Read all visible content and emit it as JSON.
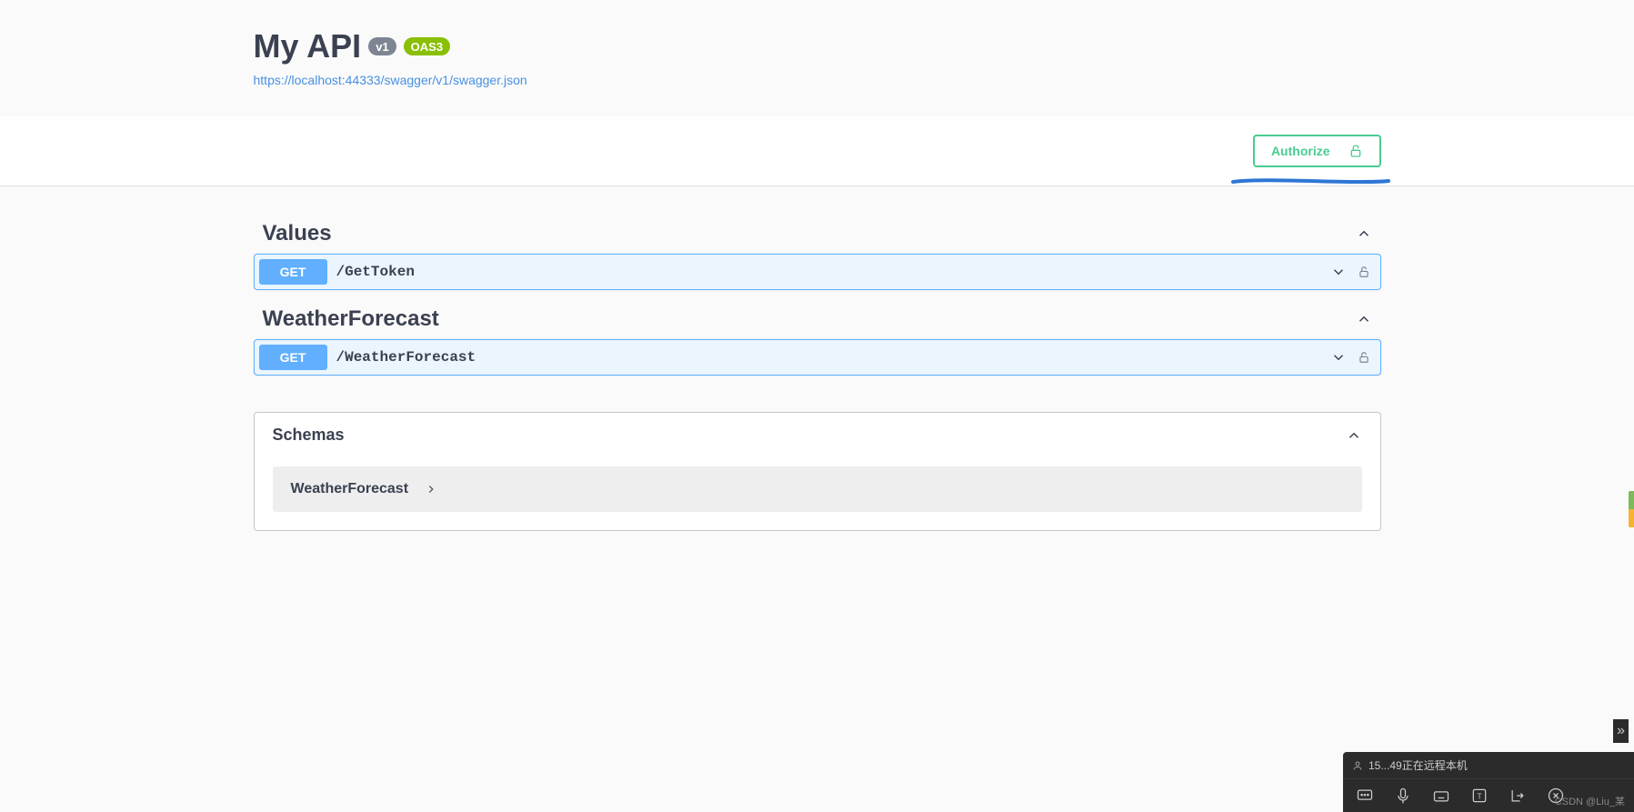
{
  "header": {
    "title": "My API",
    "version_badge": "v1",
    "oas_badge": "OAS3",
    "swagger_url": "https://localhost:44333/swagger/v1/swagger.json"
  },
  "authorize": {
    "label": "Authorize"
  },
  "tags": [
    {
      "name": "Values",
      "operations": [
        {
          "method": "GET",
          "path": "/GetToken"
        }
      ]
    },
    {
      "name": "WeatherForecast",
      "operations": [
        {
          "method": "GET",
          "path": "/WeatherForecast"
        }
      ]
    }
  ],
  "schemas": {
    "title": "Schemas",
    "items": [
      {
        "name": "WeatherForecast"
      }
    ]
  },
  "ime": {
    "status_text": "15...49正在远程本机",
    "watermark": "CSDN @Liu_某"
  }
}
